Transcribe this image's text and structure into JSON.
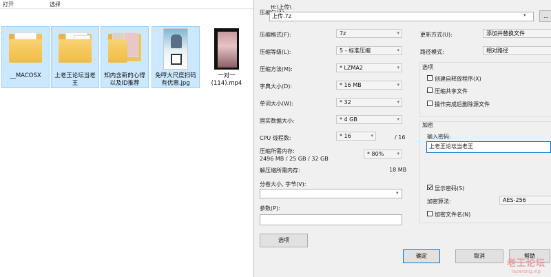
{
  "explorer": {
    "menu": {
      "open": "打开",
      "select": "选择"
    },
    "files": [
      {
        "name": "__MACOSX",
        "type": "folder"
      },
      {
        "name": "上老王论坛当老王",
        "type": "folder-docs"
      },
      {
        "name": "知内含新的心得以及ID推荐",
        "type": "folder-photo"
      },
      {
        "name": "免哼大尺度扫码有优惠.jpg",
        "type": "jpg"
      },
      {
        "name": "一对一(114).mp4",
        "type": "mp4"
      }
    ]
  },
  "dialog": {
    "archive_label": "压缩包(A):",
    "archive_path": "H:\\上传\\",
    "archive_name": "上传.7z",
    "format_label": "压缩格式(F):",
    "format_value": "7z",
    "level_label": "压缩等级(L):",
    "level_value": "5 - 标准压缩",
    "method_label": "压缩方法(M):",
    "method_value": "* LZMA2",
    "dict_label": "字典大小(D):",
    "dict_value": "* 16 MB",
    "word_label": "单词大小(W):",
    "word_value": "* 32",
    "solid_label": "固实数据大小:",
    "solid_value": "* 4 GB",
    "cpu_label": "CPU 线程数:",
    "cpu_value": "* 16",
    "cpu_total": "/ 16",
    "mem_comp_label": "压缩所需内存:",
    "mem_comp_value": "2496 MB / 25 GB / 32 GB",
    "mem_pct": "* 80%",
    "mem_decomp_label": "解压缩所需内存:",
    "mem_decomp_value": "18 MB",
    "split_label": "分卷大小, 字节(V):",
    "params_label": "参数(P):",
    "options_button": "选项",
    "update_label": "更新方式(U):",
    "update_value": "添加并替换文件",
    "path_label": "路径模式:",
    "path_value": "相对路径",
    "options_group": "选项",
    "opt_sfx": "创建自释放程序(X)",
    "opt_shared": "压缩共享文件",
    "opt_delete": "操作完成后删除源文件",
    "encrypt_group": "加密",
    "password_label": "输入密码:",
    "password_value": "上老王论坛当老王",
    "show_password": "显示密码(S)",
    "enc_method_label": "加密算法:",
    "enc_method_value": "AES-256",
    "encrypt_names": "加密文件名(N)",
    "ok": "确定",
    "cancel": "取消",
    "help": "帮助"
  },
  "watermark": {
    "line1": "老王论坛",
    "line2": "laowang.vip"
  }
}
